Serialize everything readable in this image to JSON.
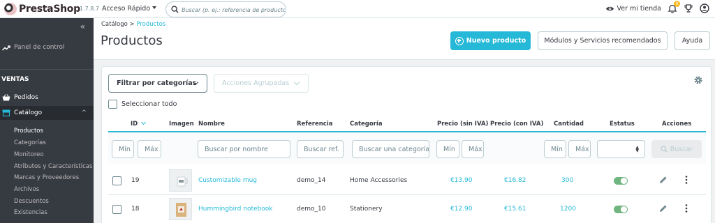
{
  "app": {
    "logo_text": "PrestaShop",
    "version": "1.7.8.7",
    "quick_access": "Acceso Rápido",
    "search_placeholder": "Buscar (p. ej.: referencia de producto, nombre de cliente…)",
    "view_store": "Ver mi tienda",
    "notifications_count": "0",
    "accent_color": "#25b9d7",
    "sidebar_color": "#363a41"
  },
  "sidebar": {
    "dashboard": "Panel de control",
    "section_sales": "VENTAS",
    "orders": "Pedidos",
    "catalog": "Catálogo",
    "catalog_items": [
      "Productos",
      "Categorías",
      "Monitoreo",
      "Atributos y Características",
      "Marcas y Proveedores",
      "Archivos",
      "Descuentos",
      "Existencias"
    ]
  },
  "header": {
    "breadcrumb_parent": "Catálogo",
    "breadcrumb_separator": ">",
    "breadcrumb_current": "Productos",
    "title": "Productos",
    "new_product_label": "Nuevo producto",
    "modules_label": "Módulos y Servicios recomendados",
    "help_label": "Ayuda"
  },
  "toolbar": {
    "filter_categories": "Filtrar por categorías",
    "bulk_actions": "Acciones Agrupadas",
    "select_all": "Seleccionar todo"
  },
  "table": {
    "columns": [
      "ID",
      "Imagen",
      "Nombre",
      "Referencia",
      "Categoría",
      "Precio (sin IVA)",
      "Precio (con IVA)",
      "Cantidad",
      "Estatus",
      "Acciones"
    ],
    "filters": {
      "id_min": "Mín",
      "id_max": "Máx",
      "name": "Buscar por nombre",
      "reference": "Buscar ref.",
      "category": "Buscar una categoría",
      "price_min": "Mín",
      "price_max": "Máx",
      "qty_min": "Mín",
      "qty_max": "Máx",
      "search_button": "Buscar"
    },
    "rows": [
      {
        "id": "19",
        "name": "Customizable mug",
        "reference": "demo_14",
        "category": "Home Accessories",
        "price_excl": "€13.90",
        "price_incl": "€16.82",
        "quantity": "300",
        "status": "enabled",
        "image_icon": "mug-thumbnail"
      },
      {
        "id": "18",
        "name": "Hummingbird notebook",
        "reference": "demo_10",
        "category": "Stationery",
        "price_excl": "€12.90",
        "price_incl": "€15.61",
        "quantity": "1200",
        "status": "enabled",
        "image_icon": "notebook-thumbnail"
      }
    ]
  }
}
